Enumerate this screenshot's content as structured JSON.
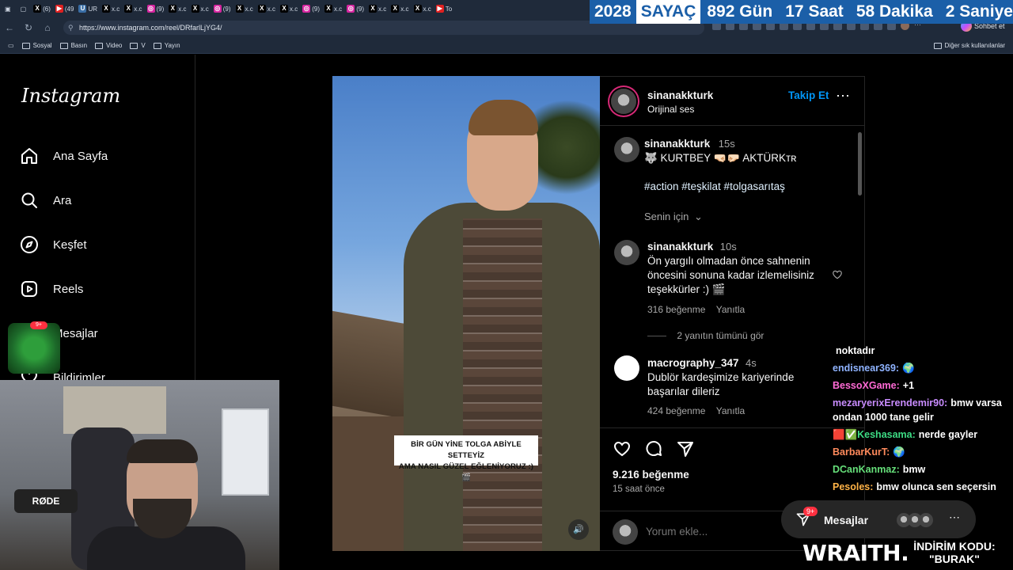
{
  "browser": {
    "tabs": [
      {
        "icon": "x-icon",
        "label": "(6)"
      },
      {
        "icon": "youtube-icon",
        "label": "(49"
      },
      {
        "icon": "generic-icon",
        "label": "UR"
      },
      {
        "icon": "x-icon",
        "label": "x.c"
      },
      {
        "icon": "x-icon",
        "label": "x.c"
      },
      {
        "icon": "instagram-icon",
        "label": "(9)"
      },
      {
        "icon": "x-icon",
        "label": "x.c"
      },
      {
        "icon": "x-icon",
        "label": "x.c"
      },
      {
        "icon": "instagram-icon",
        "label": "(9)"
      },
      {
        "icon": "x-icon",
        "label": "x.c"
      },
      {
        "icon": "x-icon",
        "label": "x.c"
      },
      {
        "icon": "x-icon",
        "label": "x.c"
      },
      {
        "icon": "instagram-icon",
        "label": "(9)"
      },
      {
        "icon": "x-icon",
        "label": "x.c"
      },
      {
        "icon": "instagram-icon",
        "label": "(9)"
      },
      {
        "icon": "x-icon",
        "label": "x.c"
      },
      {
        "icon": "x-icon",
        "label": "x.c"
      },
      {
        "icon": "x-icon",
        "label": "x.c"
      },
      {
        "icon": "youtube-icon",
        "label": "To"
      }
    ],
    "url": "https://www.instagram.com/reel/DRfarlLjYG4/",
    "copilot_label": "Sohbet et",
    "bookmarks": [
      "Sosyal",
      "Basın",
      "Video",
      "V",
      "Yayın"
    ],
    "other_bookmarks": "Diğer sık kullanılanlar"
  },
  "counter": {
    "year": "2028",
    "label": "SAYAÇ",
    "days": "892 Gün",
    "hours": "17 Saat",
    "minutes": "58 Dakika",
    "seconds": "2 Saniye"
  },
  "sidebar": {
    "logo": "Instagram",
    "items": [
      {
        "label": "Ana Sayfa",
        "icon": "home-icon"
      },
      {
        "label": "Ara",
        "icon": "search-icon"
      },
      {
        "label": "Keşfet",
        "icon": "compass-icon"
      },
      {
        "label": "Reels",
        "icon": "reels-icon"
      },
      {
        "label": "Mesajlar",
        "icon": "messenger-icon"
      },
      {
        "label": "Bildirimler",
        "icon": "heart-icon"
      }
    ]
  },
  "video": {
    "caption_line1": "BİR GÜN YİNE TOLGA ABİYLE SETTEYİZ",
    "caption_line2": "AMA NASIL GÜZEL EĞLENİYORUZ :) 🎬"
  },
  "post": {
    "username": "sinanakkturk",
    "audio": "Orijinal ses",
    "follow": "Takip Et",
    "caption": {
      "username": "sinanakkturk",
      "time": "15s",
      "text": "🐺 KURTBEY 🤜🏻🤛🏻 AKTÜRKᴛʀ",
      "hashtags": "#action #teşkilat #tolgasarıtaş",
      "for_you": "Senin için"
    },
    "comments": [
      {
        "username": "sinanakkturk",
        "time": "10s",
        "text": "Ön yargılı olmadan önce sahnenin öncesini sonuna kadar izlemelisiniz teşekkürler :) 🎬",
        "likes": "316 beğenme",
        "reply": "Yanıtla",
        "view_replies": "2 yanıtın tümünü gör"
      },
      {
        "username": "macrography_347",
        "time": "4s",
        "text": "Dublör kardeşimize kariyerinde başarılar dileriz",
        "likes": "424 beğenme",
        "reply": "Yanıtla"
      }
    ],
    "like_count": "9.216 beğenme",
    "posted": "15 saat önce",
    "comment_placeholder": "Yorum ekle..."
  },
  "overlay": {
    "chat": [
      {
        "user": "",
        "text": "noktadır",
        "color": "#ffffff"
      },
      {
        "user": "endisnear369:",
        "text": "🌍",
        "color": "#8fb3ff"
      },
      {
        "user": "BessoXGame:",
        "text": "+1",
        "color": "#ff6ad5"
      },
      {
        "user": "mezaryerixErendemir90:",
        "text": "bmw varsa ondan 1000 tane gelir",
        "color": "#c98cff"
      },
      {
        "user": "🟥✅Keshasama:",
        "text": "nerde gayler",
        "color": "#3ddc84"
      },
      {
        "user": "BarbarKurT:",
        "text": "🌍",
        "color": "#ff8a5c"
      },
      {
        "user": "DCanKanmaz:",
        "text": "bmw",
        "color": "#66e07a"
      },
      {
        "user": "Pesoles:",
        "text": "bmw olunca sen seçersin",
        "color": "#ffb347"
      }
    ],
    "messages_label": "Mesajlar",
    "messages_badge": "9+",
    "mic_brand": "RØDE",
    "sponsor": "WRAITH.",
    "discount_line1": "İNDİRİM KODU:",
    "discount_line2": "\"BURAK\"",
    "candy_badge": "9+"
  }
}
